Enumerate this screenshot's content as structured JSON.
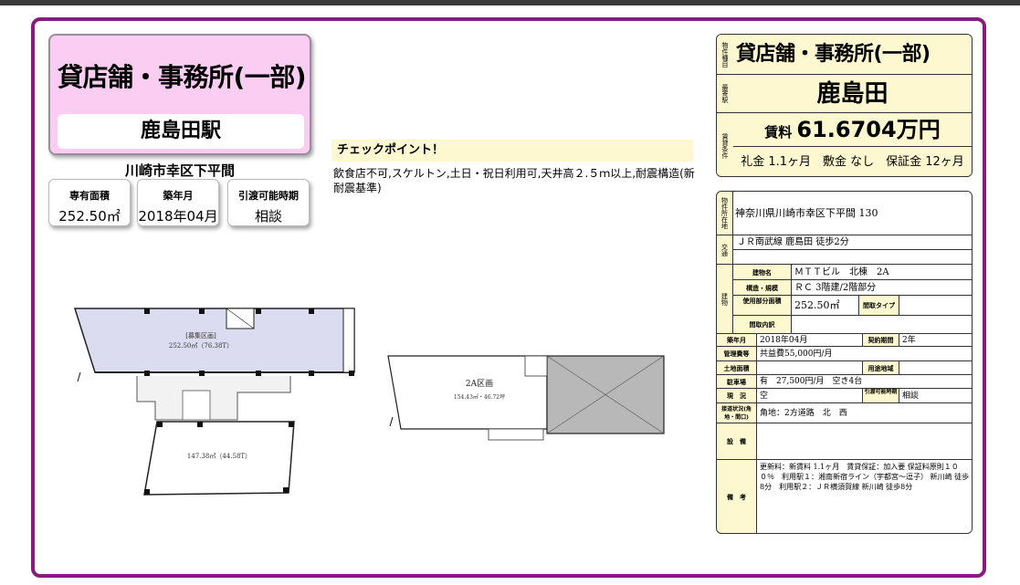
{
  "listing": {
    "type_title": "貸店舗・事務所(一部)",
    "station": "鹿島田駅",
    "address_short": "川崎市幸区下平間"
  },
  "stats": [
    {
      "label": "専有面積",
      "value": "252.50㎡"
    },
    {
      "label": "築年月",
      "value": "2018年04月"
    },
    {
      "label": "引渡可能時期",
      "value": "相談"
    }
  ],
  "checkpoint": {
    "heading": "チェックポイント！",
    "text": "飲食店不可,スケルトン,土日・祝日利用可,天井高２.５ｍ以上,耐震構造(新耐震基準)"
  },
  "header_box": {
    "type_side": "物件種目",
    "type_value": "貸店舗・事務所(一部)",
    "station_side": "最寄駅",
    "station_value": "鹿島田",
    "terms_side": "賃貸条件",
    "rent_label": "賃料",
    "rent_value": "61.6704万円",
    "terms_line": "礼金 1.1ヶ月　敷金 なし　保証金 12ヶ月"
  },
  "spec": {
    "location_side": "物件所在地",
    "location": "神奈川県川崎市幸区下平間 130",
    "transport_side": "交通",
    "transport": "ＪＲ南武線 鹿島田 徒歩2分",
    "building_side": "建物",
    "building_name_label": "建物名",
    "building_name": "ＭＴＴビル　北棟　2A",
    "structure_label": "構造・規模",
    "structure": "ＲＣ 3階建/2階部分",
    "area_label": "使用部分面積",
    "area": "252.50㎡",
    "layout_type_label": "間取タイプ",
    "layout_detail_label": "間取内訳",
    "built_label": "築年月",
    "built": "2018年04月",
    "contract_label": "契約期間",
    "contract": "2年",
    "mgmt_label": "管理費等",
    "mgmt": "共益費55,000円/月",
    "land_label": "土地面積",
    "zoning_label": "用途地域",
    "parking_label": "駐車場",
    "parking": "有　27,500円/月　空き4台",
    "status_label": "現　況",
    "status": "空",
    "handover_label": "引渡可能時期",
    "handover": "相談",
    "road_label": "接道状況(角地・間口)",
    "road": "角地：2方道路　北　西",
    "equip_label": "設　備",
    "notes_label": "備　考",
    "notes": "更新料：新賃料 1.1ヶ月　賃貸保証：加入要 保証料原則１００％　利用駅１：湘南新宿ライン（宇都宮～逗子） 新川崎 徒歩8分　利用駅２：ＪＲ横須賀線 新川崎 徒歩8分"
  },
  "plans": {
    "left_upper_label": "[募集区画]",
    "left_upper_area": "252.50㎡（76.38T）",
    "left_lower_area": "147.38㎡（44.58T）",
    "right_unit": "2A区画",
    "right_area": "154.43㎡・46.72坪"
  },
  "colors": {
    "frame": "#8a1a7c",
    "title_bg": "#fbcdf2",
    "yellow": "#fdf8d0",
    "plan_fill": "#dcdcf0"
  }
}
